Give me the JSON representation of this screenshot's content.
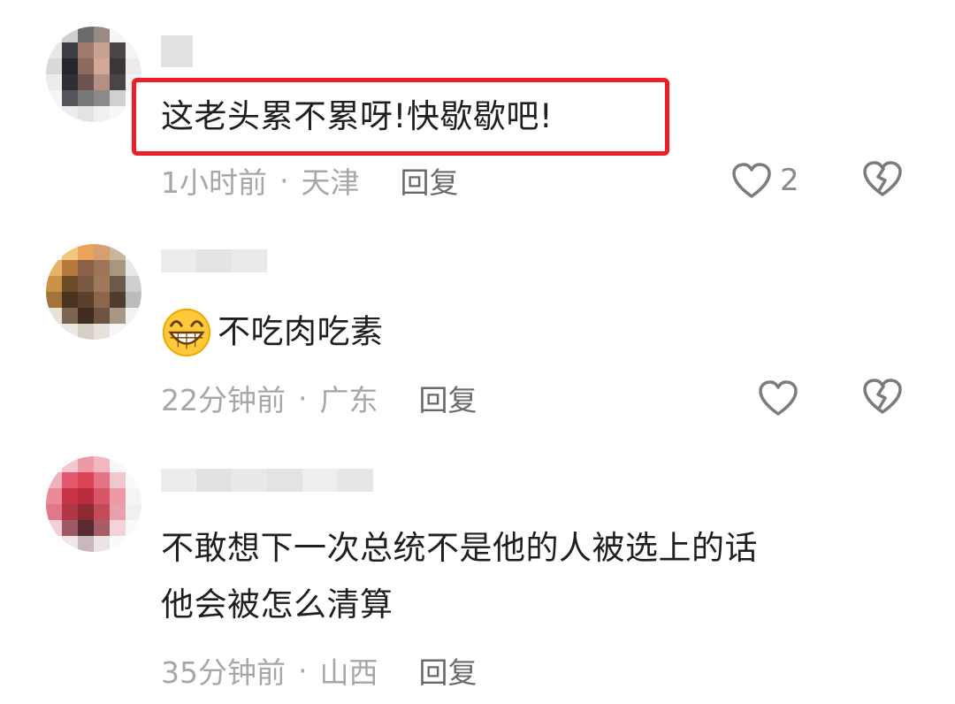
{
  "comments": [
    {
      "text": "这老头累不累呀!快歇歇吧!",
      "time": "1小时前",
      "location": "天津",
      "reply_label": "回复",
      "likes": "2"
    },
    {
      "text": "不吃肉吃素",
      "time": "22分钟前",
      "location": "广东",
      "reply_label": "回复"
    },
    {
      "text_line1": "不敢想下一次总统不是他的人被选上的话",
      "text_line2": "他会被怎么清算",
      "time": "35分钟前",
      "location": "山西",
      "reply_label": "回复"
    }
  ],
  "separator": "·",
  "icons": {
    "like": "heart-outline-icon",
    "dislike": "broken-heart-icon",
    "emoji": "grinning-face-emoji"
  },
  "colors": {
    "highlight_border": "#ee1d2a",
    "meta_text": "#a7a7a7",
    "reply_text": "#6a6a6a"
  }
}
